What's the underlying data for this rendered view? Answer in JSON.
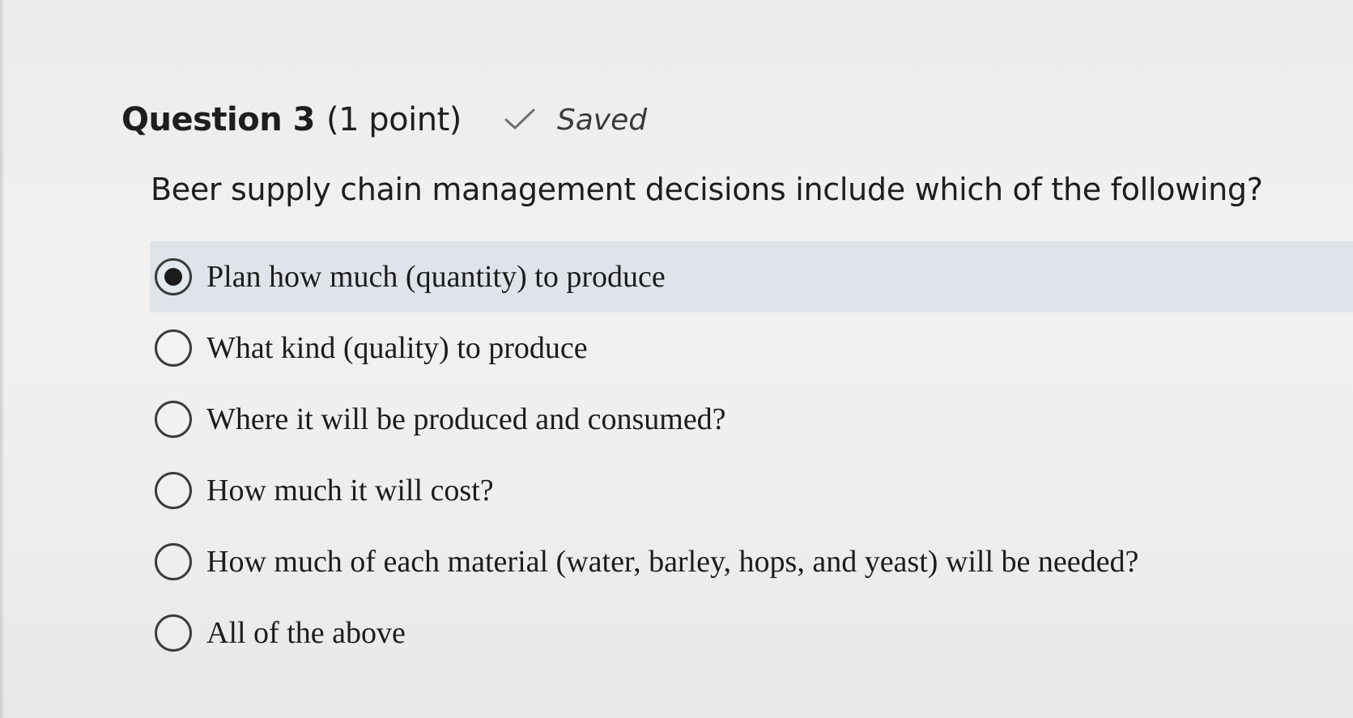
{
  "question": {
    "title": "Question 3",
    "points": "(1 point)",
    "status_icon": "check-icon",
    "status": "Saved",
    "prompt": "Beer supply chain management decisions include which of the following?"
  },
  "options": [
    {
      "label": "Plan how much (quantity) to produce",
      "selected": true
    },
    {
      "label": "What kind (quality) to produce",
      "selected": false
    },
    {
      "label": "Where it will be produced and consumed?",
      "selected": false
    },
    {
      "label": "How much it will cost?",
      "selected": false
    },
    {
      "label": "How much of each material (water, barley, hops, and yeast) will be needed?",
      "selected": false
    },
    {
      "label": "All of the above",
      "selected": false
    }
  ],
  "colors": {
    "selected_row_background": "#dfe4ea",
    "radio_border": "#3c3c3c",
    "text": "#1e1e1e"
  }
}
